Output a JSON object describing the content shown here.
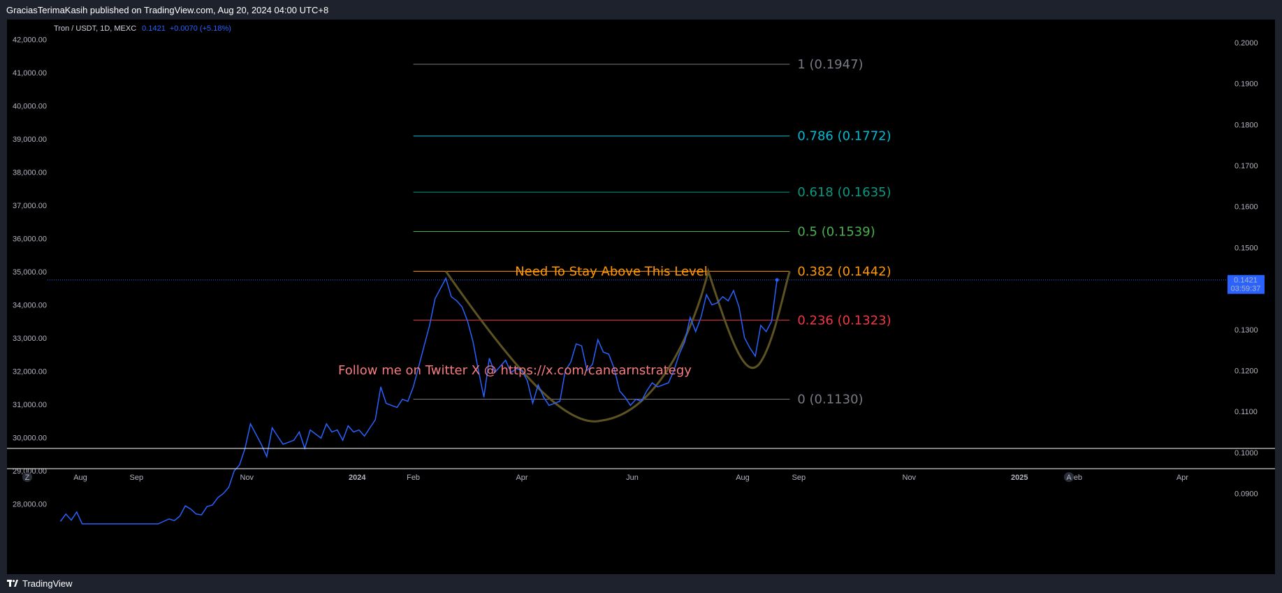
{
  "header": {
    "publish_info": "GraciasTerimaKasih published on TradingView.com, Aug 20, 2024 04:00 UTC+8"
  },
  "legend": {
    "symbol": "Tron / USDT, 1D, MEXC",
    "price": "0.1421",
    "change": "+0.0070 (+5.18%)"
  },
  "footer": {
    "brand": "TradingView"
  },
  "nav": {
    "zoom_btn": "Z",
    "auto_btn": "A"
  },
  "price_tag": {
    "price": "0.1421",
    "countdown": "03:59:37"
  },
  "colors": {
    "background": "#000000",
    "line": "#2962ff",
    "level_1": "#787b86",
    "level_0786": "#00bcd4",
    "level_0618": "#089981",
    "level_05": "#4caf50",
    "level_0382": "#ff9800",
    "level_0236": "#f23645",
    "level_0": "#787b86",
    "cup": "#5d5322",
    "twitter_text": "#f77c80",
    "price_tag": "#2962ff"
  },
  "annotations": {
    "stay_above": "Need To Stay Above This Level",
    "twitter": "Follow me on Twitter X @ https://x.com/canearnstrategy"
  },
  "chart_data": {
    "type": "line",
    "title": "Tron / USDT, 1D, MEXC",
    "left_axis_ticks": [
      "42,000.00",
      "41,000.00",
      "40,000.00",
      "39,000.00",
      "38,000.00",
      "37,000.00",
      "36,000.00",
      "35,000.00",
      "34,000.00",
      "33,000.00",
      "32,000.00",
      "31,000.00",
      "30,000.00",
      "29,000.00",
      "28,000.00"
    ],
    "left_axis_values": [
      42000,
      41000,
      40000,
      39000,
      38000,
      37000,
      36000,
      35000,
      34000,
      33000,
      32000,
      31000,
      30000,
      29000,
      28000
    ],
    "right_axis_ticks": [
      "0.2000",
      "0.1900",
      "0.1800",
      "0.1700",
      "0.1600",
      "0.1500",
      "0.1300",
      "0.1200",
      "0.1100",
      "0.1000",
      "0.0900"
    ],
    "right_axis_values": [
      0.2,
      0.19,
      0.18,
      0.17,
      0.16,
      0.15,
      0.13,
      0.12,
      0.11,
      0.1,
      0.09
    ],
    "ylim": [
      0.0826,
      0.2056
    ],
    "x_axis_ticks": [
      "Aug",
      "Sep",
      "Nov",
      "2024",
      "Feb",
      "Apr",
      "Jun",
      "Aug",
      "Sep",
      "Nov",
      "2025",
      "Feb",
      "Apr"
    ],
    "x_axis_dates": [
      "2023-08-01",
      "2023-09-01",
      "2023-11-01",
      "2024-01-01",
      "2024-02-01",
      "2024-04-01",
      "2024-06-01",
      "2024-08-01",
      "2024-09-01",
      "2024-11-01",
      "2025-01-01",
      "2025-02-01",
      "2025-04-01"
    ],
    "fib_levels": [
      {
        "ratio": 1,
        "label": "1 (0.1947)",
        "price": 0.1947
      },
      {
        "ratio": 0.786,
        "label": "0.786 (0.1772)",
        "price": 0.1772
      },
      {
        "ratio": 0.618,
        "label": "0.618 (0.1635)",
        "price": 0.1635
      },
      {
        "ratio": 0.5,
        "label": "0.5 (0.1539)",
        "price": 0.1539
      },
      {
        "ratio": 0.382,
        "label": "0.382 (0.1442)",
        "price": 0.1442
      },
      {
        "ratio": 0.236,
        "label": "0.236 (0.1323)",
        "price": 0.1323
      },
      {
        "ratio": 0,
        "label": "0 (0.1130)",
        "price": 0.113
      }
    ],
    "fib_start_date": "2024-02-01",
    "fib_end_date": "2024-08-27",
    "current_price": 0.1421,
    "series": [
      {
        "x": [
          "2023-07-21",
          "2023-07-24",
          "2023-07-27",
          "2023-07-30",
          "2023-08-02",
          "2023-08-05",
          "2023-08-08",
          "2023-08-11",
          "2023-08-14",
          "2023-08-17",
          "2023-08-20",
          "2023-08-23",
          "2023-08-26",
          "2023-08-29",
          "2023-09-01",
          "2023-09-04",
          "2023-09-07",
          "2023-09-10",
          "2023-09-13",
          "2023-09-16",
          "2023-09-19",
          "2023-09-22",
          "2023-09-25",
          "2023-09-28",
          "2023-10-01",
          "2023-10-04",
          "2023-10-07",
          "2023-10-10",
          "2023-10-13",
          "2023-10-16",
          "2023-10-19",
          "2023-10-22",
          "2023-10-25",
          "2023-10-28",
          "2023-10-31",
          "2023-11-03",
          "2023-11-06",
          "2023-11-09",
          "2023-11-12",
          "2023-11-15",
          "2023-11-18",
          "2023-11-21",
          "2023-11-24",
          "2023-11-27",
          "2023-11-30",
          "2023-12-03",
          "2023-12-06",
          "2023-12-09",
          "2023-12-12",
          "2023-12-15",
          "2023-12-18",
          "2023-12-21",
          "2023-12-24",
          "2023-12-27",
          "2023-12-30",
          "2024-01-02",
          "2024-01-05",
          "2024-01-08",
          "2024-01-11",
          "2024-01-14",
          "2024-01-17",
          "2024-01-20",
          "2024-01-23",
          "2024-01-26",
          "2024-01-29",
          "2024-02-01",
          "2024-02-04",
          "2024-02-07",
          "2024-02-10",
          "2024-02-13",
          "2024-02-16",
          "2024-02-19",
          "2024-02-22",
          "2024-02-25",
          "2024-02-28",
          "2024-03-02",
          "2024-03-05",
          "2024-03-08",
          "2024-03-11",
          "2024-03-14",
          "2024-03-17",
          "2024-03-20",
          "2024-03-23",
          "2024-03-26",
          "2024-03-29",
          "2024-04-01",
          "2024-04-04",
          "2024-04-07",
          "2024-04-10",
          "2024-04-13",
          "2024-04-16",
          "2024-04-19",
          "2024-04-22",
          "2024-04-25",
          "2024-04-28",
          "2024-05-01",
          "2024-05-04",
          "2024-05-07",
          "2024-05-10",
          "2024-05-13",
          "2024-05-16",
          "2024-05-19",
          "2024-05-22",
          "2024-05-25",
          "2024-05-28",
          "2024-05-31",
          "2024-06-03",
          "2024-06-06",
          "2024-06-09",
          "2024-06-12",
          "2024-06-15",
          "2024-06-18",
          "2024-06-21",
          "2024-06-24",
          "2024-06-27",
          "2024-06-30",
          "2024-07-03",
          "2024-07-06",
          "2024-07-09",
          "2024-07-12",
          "2024-07-15",
          "2024-07-18",
          "2024-07-21",
          "2024-07-24",
          "2024-07-27",
          "2024-07-30",
          "2024-08-02",
          "2024-08-05",
          "2024-08-08",
          "2024-08-11",
          "2024-08-14",
          "2024-08-17",
          "2024-08-20"
        ],
        "y": [
          0.0832,
          0.085,
          0.0835,
          0.0855,
          0.0826,
          0.0826,
          0.0826,
          0.0826,
          0.0826,
          0.0826,
          0.0826,
          0.0826,
          0.0826,
          0.0826,
          0.0826,
          0.0826,
          0.0826,
          0.0826,
          0.0826,
          0.0832,
          0.0838,
          0.0834,
          0.0845,
          0.087,
          0.0862,
          0.085,
          0.0848,
          0.0868,
          0.0872,
          0.089,
          0.09,
          0.0915,
          0.0955,
          0.097,
          0.101,
          0.107,
          0.1045,
          0.102,
          0.099,
          0.106,
          0.104,
          0.102,
          0.1025,
          0.103,
          0.105,
          0.101,
          0.1055,
          0.1045,
          0.1035,
          0.107,
          0.105,
          0.1055,
          0.103,
          0.1065,
          0.105,
          0.1055,
          0.104,
          0.106,
          0.108,
          0.116,
          0.112,
          0.1115,
          0.111,
          0.113,
          0.1125,
          0.116,
          0.121,
          0.126,
          0.131,
          0.1375,
          0.14,
          0.1425,
          0.138,
          0.137,
          0.1355,
          0.132,
          0.127,
          0.12,
          0.1135,
          0.123,
          0.1195,
          0.121,
          0.1225,
          0.1195,
          0.1205,
          0.12,
          0.1175,
          0.112,
          0.1165,
          0.1135,
          0.1115,
          0.112,
          0.1125,
          0.12,
          0.122,
          0.1265,
          0.126,
          0.12,
          0.1215,
          0.1275,
          0.1245,
          0.124,
          0.1205,
          0.115,
          0.1135,
          0.1115,
          0.113,
          0.1125,
          0.115,
          0.117,
          0.116,
          0.1165,
          0.117,
          0.12,
          0.124,
          0.127,
          0.133,
          0.1295,
          0.133,
          0.1385,
          0.136,
          0.1365,
          0.138,
          0.137,
          0.1395,
          0.1355,
          0.128,
          0.1255,
          0.1235,
          0.131,
          0.1295,
          0.132,
          0.1421
        ]
      }
    ]
  }
}
